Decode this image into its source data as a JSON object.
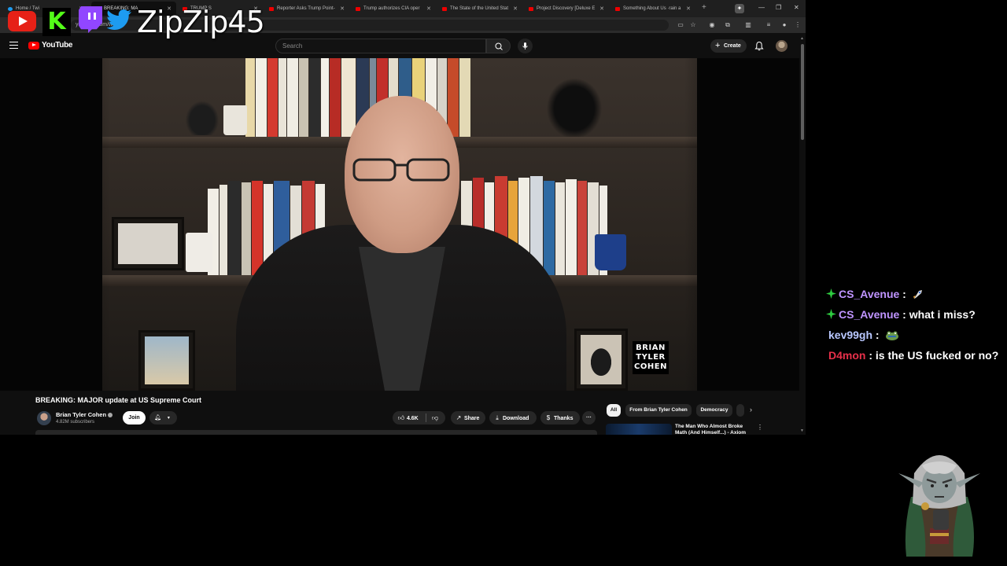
{
  "browser": {
    "tabs": [
      {
        "label": "Home / Twi",
        "icon": "twitter-icon"
      },
      {
        "label": "BREAKING: MA",
        "icon": "youtube-icon",
        "active": true
      },
      {
        "label": "TRUMP S",
        "icon": "youtube-icon"
      },
      {
        "label": "Reporter Asks Trump Point-",
        "icon": "youtube-icon"
      },
      {
        "label": "Trump authorizes CIA oper",
        "icon": "youtube-icon"
      },
      {
        "label": "The State of the United Stat",
        "icon": "youtube-icon"
      },
      {
        "label": "Project Discovery [Deluxe E",
        "icon": "youtube-icon"
      },
      {
        "label": "Something About Us ·rain a",
        "icon": "youtube-icon"
      }
    ],
    "url": "youtube.com/watch"
  },
  "overlay": {
    "streamer_name": "ZipZip45",
    "kick_letter": "K"
  },
  "youtube": {
    "logo_text": "YouTube",
    "search_placeholder": "Search",
    "create_label": "Create"
  },
  "video": {
    "badge_lines": [
      "BRIAN",
      "TYLER",
      "COHEN"
    ],
    "title": "BREAKING: MAJOR update at US Supreme Court",
    "channel_name": "Brian Tyler Cohen",
    "subscribers": "4.82M subscribers",
    "join_label": "Join",
    "likes": "4.6K",
    "share_label": "Share",
    "download_label": "Download",
    "thanks_label": "Thanks",
    "more_label": "···"
  },
  "recommendations": {
    "chips": [
      "All",
      "From Brian Tyler Cohen",
      "Democracy"
    ],
    "first_title": "The Man Who Almost Broke Math (And Himself...) - Axiom"
  },
  "chat": {
    "messages": [
      {
        "user": "CS_Avenue",
        "text": "",
        "color": "#bf94ff",
        "badge": "prime",
        "emote": "rocket-emote"
      },
      {
        "user": "CS_Avenue",
        "text": "what i miss?",
        "color": "#bf94ff",
        "badge": "prime"
      },
      {
        "user": "kev99gh",
        "text": "",
        "color": "#b9c8ff",
        "badge": "",
        "emote": "frog-emote"
      },
      {
        "user": "D4mon",
        "text": "is the US fucked or no?",
        "color": "#e8304a",
        "badge": ""
      }
    ]
  },
  "colors": {
    "yt_red": "#ff0000",
    "twitch_purple": "#9146ff",
    "kick_green": "#53fc18",
    "prime_green": "#2ecc40"
  }
}
